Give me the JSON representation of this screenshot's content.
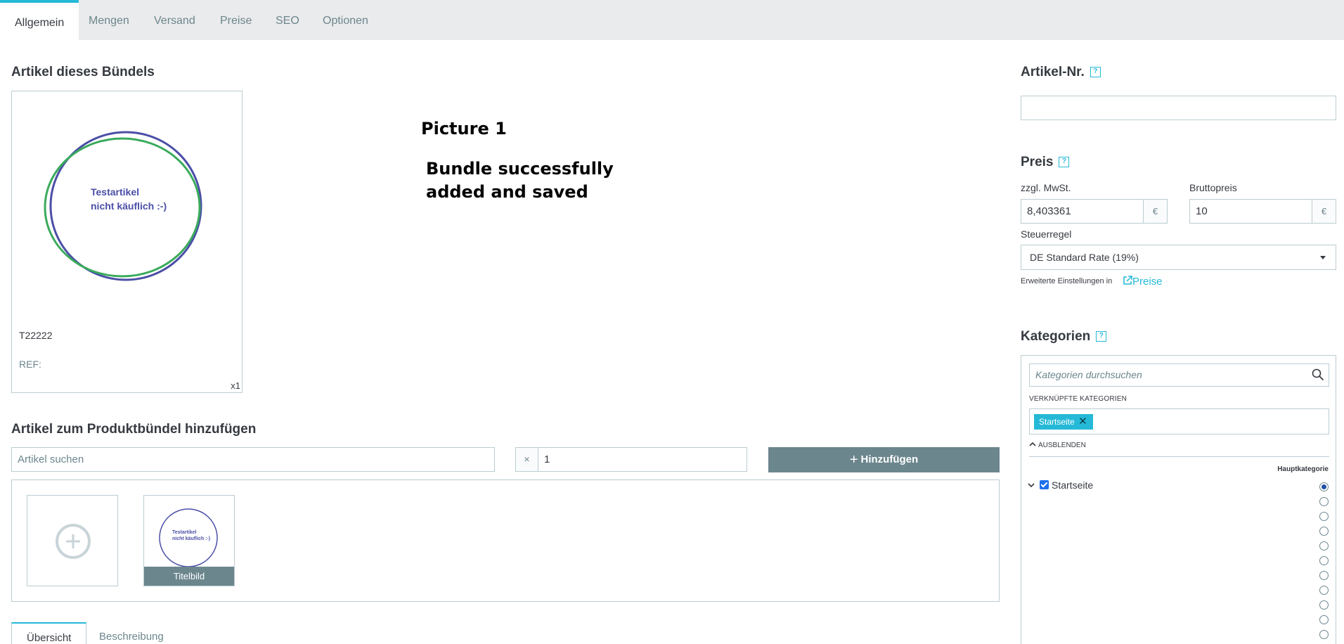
{
  "tabs": [
    "Allgemein",
    "Mengen",
    "Versand",
    "Preise",
    "SEO",
    "Optionen"
  ],
  "active_tab": "Allgemein",
  "bundle": {
    "title": "Artikel dieses Bündels",
    "image_text_line1": "Testartikel",
    "image_text_line2": "nicht käuflich :-)",
    "reference": "T22222",
    "ref_label": "REF:",
    "quantity": "x1"
  },
  "annotation": {
    "line1": "Picture 1",
    "line2": "Bundle successfully",
    "line3": "added and saved"
  },
  "add_section": {
    "title": "Artikel zum Produktbündel hinzufügen",
    "search_placeholder": "Artikel suchen",
    "qty_prefix": "×",
    "qty_value": "1",
    "add_button": "Hinzufügen"
  },
  "images": {
    "thumb_text_line1": "Testartikel",
    "thumb_text_line2": "nicht käuflich :-)",
    "cover_caption": "Titelbild"
  },
  "bottom_tabs": [
    "Übersicht",
    "Beschreibung"
  ],
  "sku": {
    "title": "Artikel-Nr.",
    "help": "?",
    "value": ""
  },
  "price": {
    "title": "Preis",
    "help": "?",
    "net_label": "zzgl. MwSt.",
    "net_value": "8,403361",
    "gross_label": "Bruttopreis",
    "gross_value": "10",
    "currency": "€",
    "tax_rule_label": "Steuerregel",
    "tax_rule_value": "DE Standard Rate (19%)",
    "advanced_note": "Erweiterte Einstellungen in",
    "advanced_link": "Preise"
  },
  "categories": {
    "title": "Kategorien",
    "help": "?",
    "search_placeholder": "Kategorien durchsuchen",
    "linked_label": "VERKNÜPFTE KATEGORIEN",
    "linked_chip": "Startseite",
    "collapse_label": "AUSBLENDEN",
    "main_category_label": "Hauptkategorie",
    "tree_item": "Startseite"
  },
  "colors": {
    "accent": "#25b9d7",
    "button_gray": "#6c868e",
    "border": "#bbcdd2",
    "circle_blue": "#4b4fa6",
    "circle_green": "#3aaa5c"
  }
}
